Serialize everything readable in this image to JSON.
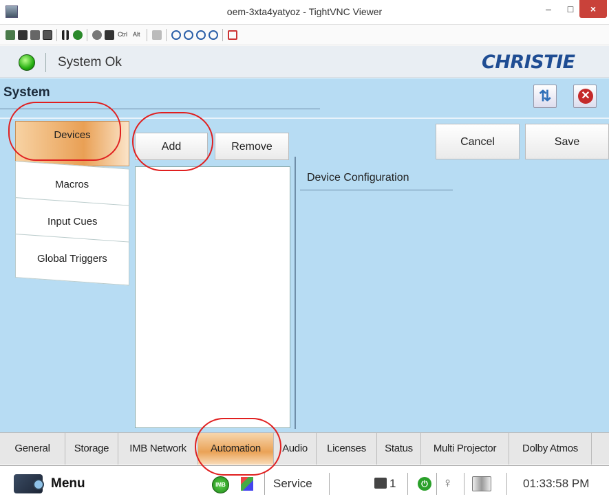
{
  "window": {
    "title": "oem-3xta4yatyoz - TightVNC Viewer",
    "minimize": "–",
    "maximize": "□",
    "close": "×"
  },
  "toolbar": {
    "ctrl_label": "Ctrl",
    "alt_label": "Alt"
  },
  "header": {
    "status_text": "System Ok",
    "logo_text": "CHRISTIE",
    "status_color": "#27b012"
  },
  "section": {
    "title": "System"
  },
  "side_tabs": [
    {
      "label": "Devices",
      "active": true
    },
    {
      "label": "Macros",
      "active": false
    },
    {
      "label": "Input Cues",
      "active": false
    },
    {
      "label": "Global Triggers",
      "active": false
    }
  ],
  "actions": {
    "add": "Add",
    "remove": "Remove",
    "cancel": "Cancel",
    "save": "Save"
  },
  "config": {
    "heading": "Device Configuration"
  },
  "bottom_tabs": [
    {
      "label": "General",
      "active": false
    },
    {
      "label": "Storage",
      "active": false
    },
    {
      "label": "IMB Network",
      "active": false
    },
    {
      "label": "Automation",
      "active": true
    },
    {
      "label": "Audio",
      "active": false
    },
    {
      "label": "Licenses",
      "active": false
    },
    {
      "label": "Status",
      "active": false
    },
    {
      "label": "Multi Projector",
      "active": false
    },
    {
      "label": "Dolby Atmos",
      "active": false
    }
  ],
  "statusbar": {
    "menu_label": "Menu",
    "imb_badge": "IMB",
    "service_label": "Service",
    "camera_count": "1",
    "time": "01:33:58 PM"
  },
  "colors": {
    "main_bg": "#b7dcf3",
    "active_tab": "#eaa256",
    "highlight": "#e01f1f",
    "logo": "#1f4d93"
  }
}
